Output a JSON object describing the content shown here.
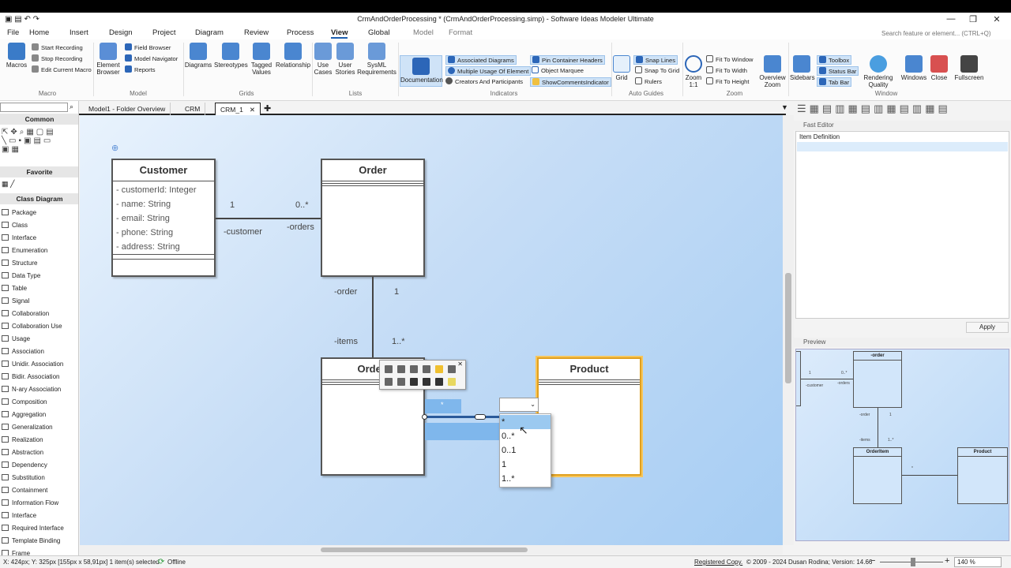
{
  "window": {
    "title": "CrmAndOrderProcessing * (CrmAndOrderProcessing.simp) - Software Ideas Modeler Ultimate",
    "min": "—",
    "max": "❐",
    "close": "✕"
  },
  "menu": {
    "items": [
      "File",
      "Home",
      "Insert",
      "Design",
      "Project",
      "Diagram",
      "Review",
      "Process",
      "View",
      "Global",
      "Model",
      "Format"
    ],
    "active": "View",
    "search_placeholder": "Search feature or element... (CTRL+Q)"
  },
  "ribbon": {
    "macro": {
      "macros": "Macros",
      "start": "Start Recording",
      "stop": "Stop Recording",
      "edit": "Edit Current Macro",
      "group": "Macro"
    },
    "model": {
      "browser": "Element Browser",
      "field": "Field Browser",
      "navigator": "Model Navigator",
      "reports": "Reports",
      "group": "Model"
    },
    "grids": {
      "diagrams": "Diagrams",
      "stereotypes": "Stereotypes",
      "tagged": "Tagged Values",
      "relationship": "Relationship",
      "group": "Grids"
    },
    "lists": {
      "usecases": "Use Cases",
      "stories": "User Stories",
      "sysml": "SysML Requirements",
      "group": "Lists"
    },
    "indicators": {
      "documentation": "Documentation",
      "associated": "Associated Diagrams",
      "multiple": "Multiple Usage Of Element",
      "creators": "Creators And Participants",
      "pin": "Pin Container Headers",
      "marquee": "Object Marquee",
      "comments": "ShowCommentsIndicator",
      "group": "Indicators"
    },
    "guides": {
      "grid": "Grid",
      "snaplines": "Snap Lines",
      "snapgrid": "Snap To Grid",
      "rulers": "Rulers",
      "group": "Auto Guides"
    },
    "zoom": {
      "zoom11": "Zoom 1:1",
      "window": "Fit To Window",
      "width": "Fit To Width",
      "height": "Fit To Height",
      "overview": "Overview Zoom",
      "group": "Zoom"
    },
    "window": {
      "sidebars": "Sidebars",
      "toolbox": "Toolbox",
      "statusbar": "Status Bar",
      "tabbar": "Tab Bar",
      "rendering": "Rendering Quality",
      "windows": "Windows",
      "close": "Close",
      "fullscreen": "Fullscreen",
      "group": "Window"
    }
  },
  "toolbox": {
    "common": "Common",
    "favorite": "Favorite",
    "section": "Class Diagram",
    "items": [
      "Package",
      "Class",
      "Interface",
      "Enumeration",
      "Structure",
      "Data Type",
      "Table",
      "Signal",
      "Collaboration",
      "Collaboration Use",
      "Usage",
      "Association",
      "Unidir. Association",
      "Bidir. Association",
      "N-ary Association",
      "Composition",
      "Aggregation",
      "Generalization",
      "Realization",
      "Abstraction",
      "Dependency",
      "Substitution",
      "Containment",
      "Information Flow",
      "Interface",
      "Required  Interface",
      "Template Binding",
      "Frame"
    ]
  },
  "tabs": [
    "Model1 - Folder Overview",
    "CRM",
    "CRM_1"
  ],
  "diagram": {
    "customer": {
      "name": "Customer",
      "attrs": [
        "- customerId: Integer",
        "- name: String",
        "- email: String",
        "- phone: String",
        "- address: String"
      ]
    },
    "order": {
      "name": "Order"
    },
    "orderitem": {
      "name": "OrderI"
    },
    "product": {
      "name": "Product"
    },
    "labels": {
      "c_mult": "1",
      "o_mult": "0..*",
      "c_role": "-customer",
      "o_role": "-orders",
      "order_role": "-order",
      "order_mult": "1",
      "items_role": "-items",
      "items_mult": "1..*",
      "assoc_mult": "*"
    }
  },
  "dropdown": {
    "options": [
      "*",
      "0..*",
      "0..1",
      "1",
      "1..*"
    ],
    "selected": "*"
  },
  "right": {
    "fast_editor": "Fast Editor",
    "item_def": "Item Definition",
    "apply": "Apply",
    "preview": "Preview"
  },
  "preview": {
    "order": "-order",
    "orderitem": "OrderItem",
    "product": "Product",
    "m1": "1",
    "m2": "0..*",
    "customer": "-customer",
    "orders": "-orders",
    "one": "1",
    "items": "-items",
    "oneplus": "1..*",
    "star": "*"
  },
  "status": {
    "coords": "X: 424px; Y: 325px [155px x 58,91px] 1 item(s) selected",
    "offline": "Offline",
    "registered": "Registered Copy.",
    "copyright": "© 2009 - 2024 Dusan Rodina; Version: 14.66",
    "zoom": "140 %"
  }
}
